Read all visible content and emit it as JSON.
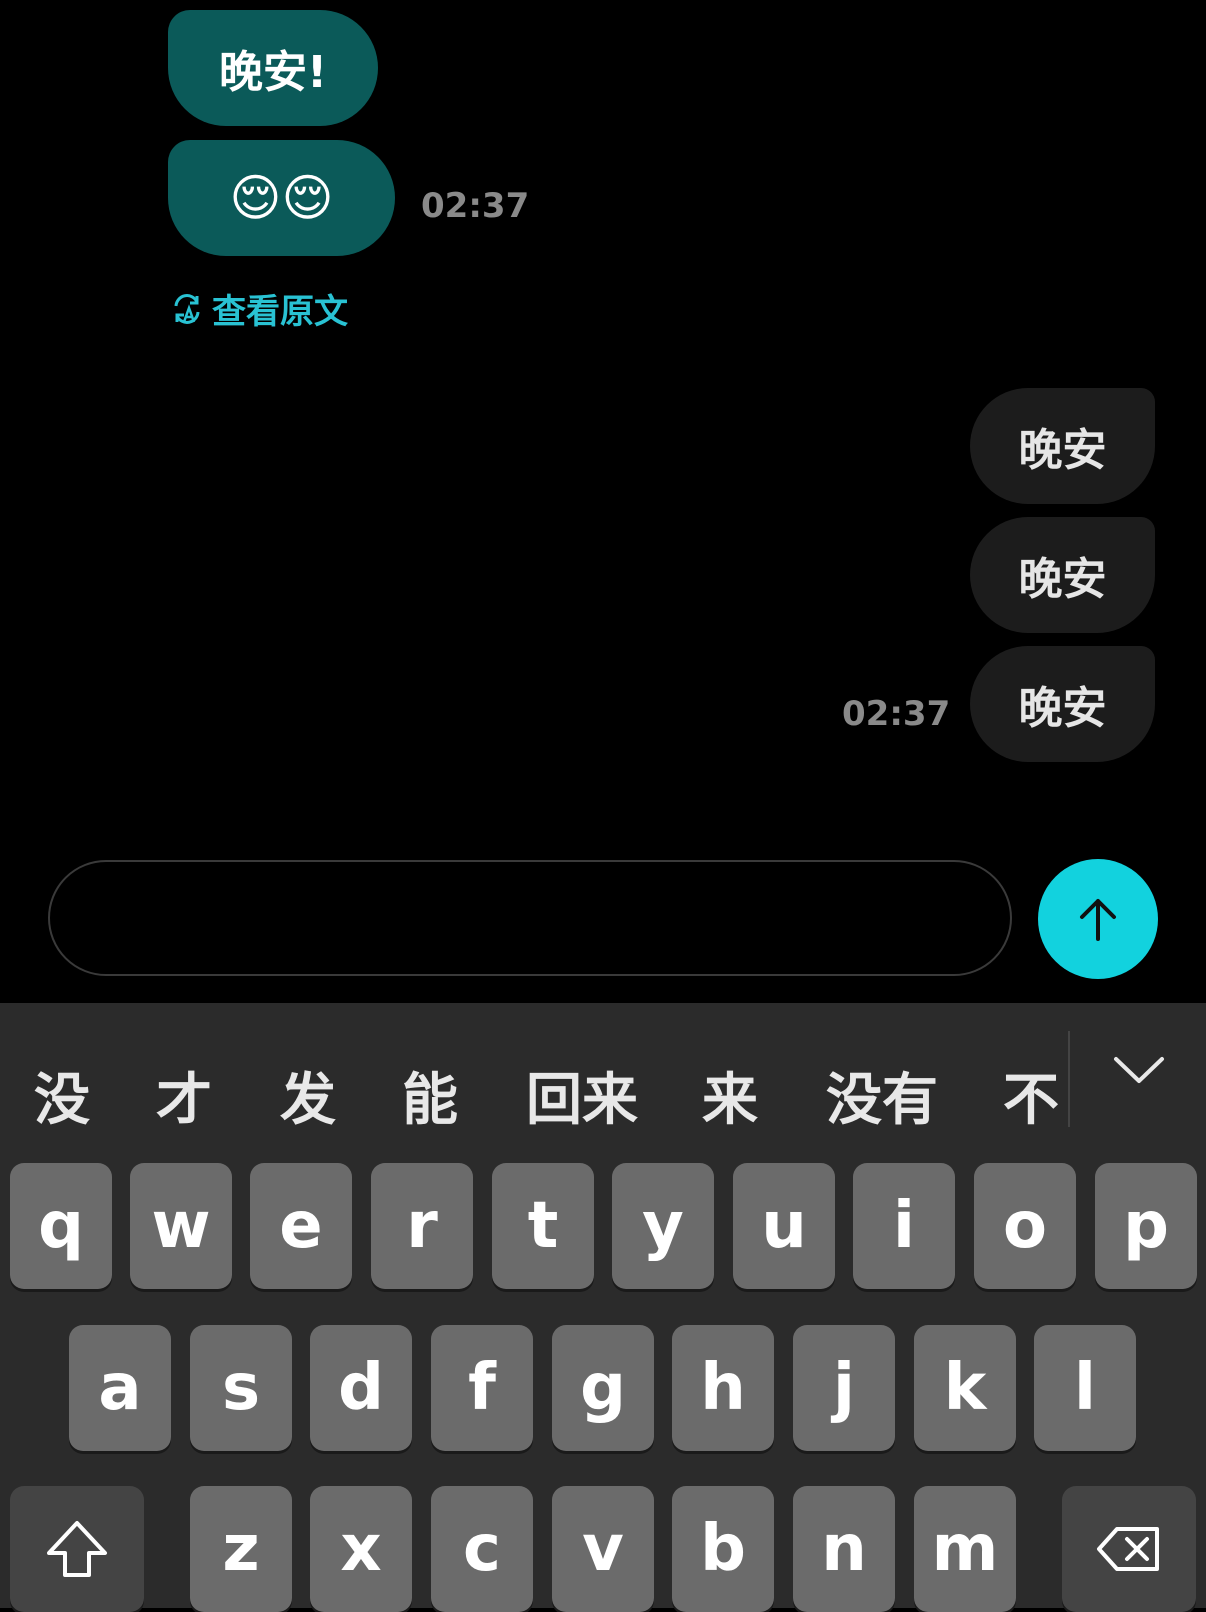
{
  "chat": {
    "incoming": [
      {
        "text": "晚安!"
      },
      {
        "text": "😌😌"
      }
    ],
    "incoming_time": "02:37",
    "translate_label": "查看原文",
    "outgoing": [
      {
        "text": "晚安"
      },
      {
        "text": "晚安"
      },
      {
        "text": "晚安"
      }
    ],
    "outgoing_time": "02:37"
  },
  "composer": {
    "placeholder": "",
    "send_icon": "arrow-up-icon"
  },
  "keyboard": {
    "candidates": [
      "没",
      "才",
      "发",
      "能",
      "回来",
      "来",
      "没有",
      "不"
    ],
    "row1": [
      "q",
      "w",
      "e",
      "r",
      "t",
      "y",
      "u",
      "i",
      "o",
      "p"
    ],
    "row2": [
      "a",
      "s",
      "d",
      "f",
      "g",
      "h",
      "j",
      "k",
      "l"
    ],
    "row3": [
      "z",
      "x",
      "c",
      "v",
      "b",
      "n",
      "m"
    ]
  },
  "colors": {
    "incoming_bubble": "#0b5a59",
    "outgoing_bubble": "#1c1c1c",
    "accent": "#12d2de",
    "translate_text": "#29c2d3"
  }
}
